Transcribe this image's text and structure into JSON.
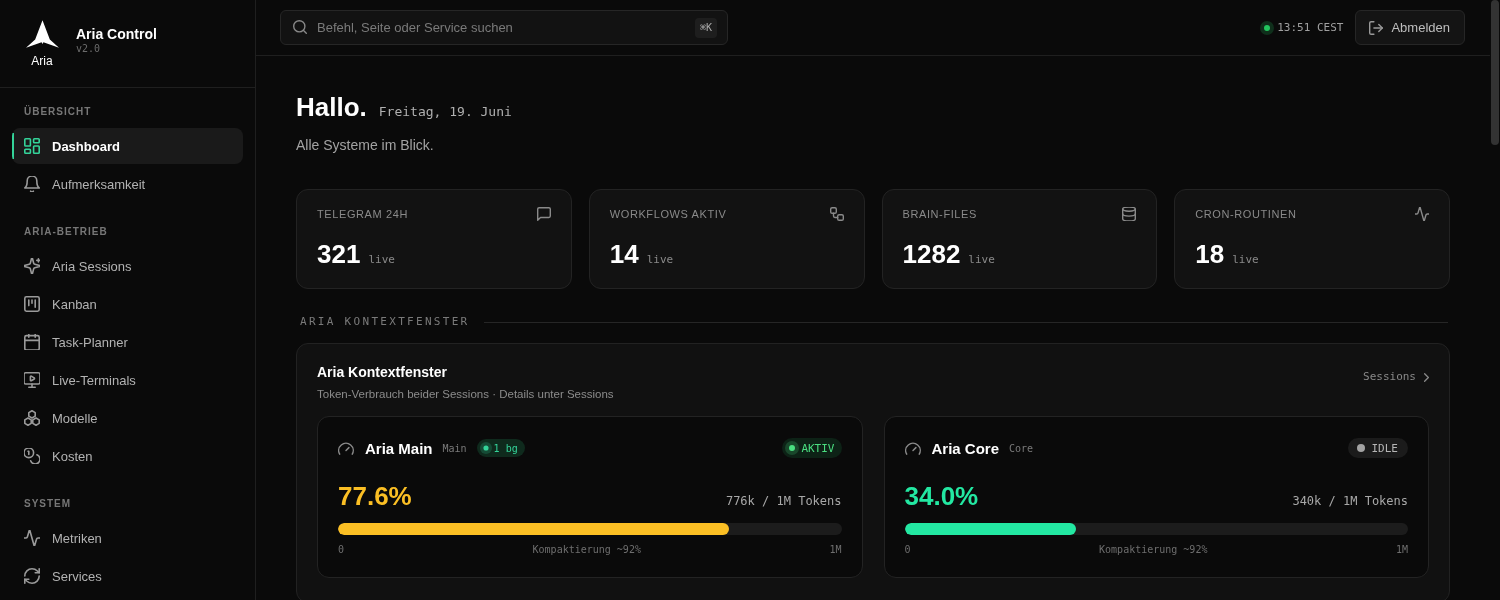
{
  "brand": {
    "logo_text": "Aria",
    "name": "Aria Control",
    "version": "v2.0"
  },
  "sidebar": {
    "sections": [
      {
        "title": "ÜBERSICHT",
        "items": [
          {
            "label": "Dashboard",
            "selected": true
          },
          {
            "label": "Aufmerksamkeit",
            "selected": false
          }
        ]
      },
      {
        "title": "ARIA-BETRIEB",
        "items": [
          {
            "label": "Aria Sessions",
            "selected": false
          },
          {
            "label": "Kanban",
            "selected": false
          },
          {
            "label": "Task-Planner",
            "selected": false
          },
          {
            "label": "Live-Terminals",
            "selected": false
          },
          {
            "label": "Modelle",
            "selected": false
          },
          {
            "label": "Kosten",
            "selected": false
          }
        ]
      },
      {
        "title": "SYSTEM",
        "items": [
          {
            "label": "Metriken",
            "selected": false
          },
          {
            "label": "Services",
            "selected": false
          }
        ]
      }
    ]
  },
  "topbar": {
    "search": {
      "placeholder": "Befehl, Seite oder Service suchen",
      "shortcut": "⌘K"
    },
    "clock": {
      "time": "13:51 CEST",
      "online": true
    },
    "logout_button": "Abmelden"
  },
  "greeting": {
    "title": "Hallo.",
    "date": "Freitag, 19. Juni",
    "subtitle": "Alle Systeme im Blick."
  },
  "stats": [
    {
      "label": "TELEGRAM 24H",
      "value": "321",
      "unit": "live"
    },
    {
      "label": "WORKFLOWS AKTIV",
      "value": "14",
      "unit": "live"
    },
    {
      "label": "BRAIN-FILES",
      "value": "1282",
      "unit": "live"
    },
    {
      "label": "CRON-ROUTINEN",
      "value": "18",
      "unit": "live"
    }
  ],
  "context": {
    "heading": "ARIA KONTEXTFENSTER",
    "title": "Aria Kontextfenster",
    "subtitle": "Token-Verbrauch beider Sessions · Details unter Sessions",
    "link": "Sessions",
    "sessions": [
      {
        "name": "Aria Main",
        "tag": "Main",
        "bg_badge": "1 bg",
        "status": "AKTIV",
        "active": true,
        "percent": "77.6%",
        "tokens": "776k / 1M Tokens",
        "level": 0.776,
        "color": "#fbbf24",
        "scale_min": "0",
        "note": "Kompaktierung ~92%",
        "scale_max": "1M"
      },
      {
        "name": "Aria Core",
        "tag": "Core",
        "status": "IDLE",
        "active": false,
        "percent": "34.0%",
        "tokens": "340k / 1M Tokens",
        "level": 0.34,
        "color": "#23e8a2",
        "scale_min": "0",
        "note": "Kompaktierung ~92%",
        "scale_max": "1M"
      }
    ]
  }
}
